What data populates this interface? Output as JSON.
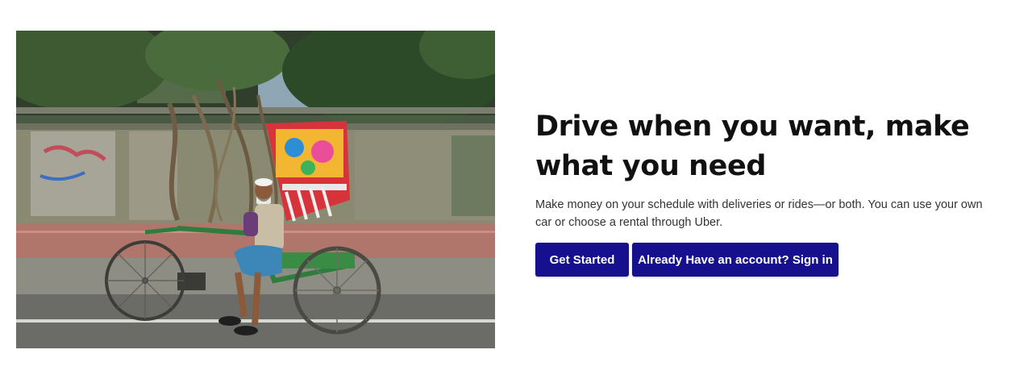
{
  "hero": {
    "image_alt": "Man sitting on a decorated cycle rickshaw in front of a weathered wall with tree roots",
    "title": "Drive when you want, make what you need",
    "subtitle": "Make money on your schedule with deliveries or rides—or both. You can use your own car or choose a rental through Uber.",
    "buttons": {
      "get_started": "Get Started",
      "sign_in": "Already Have an account? Sign in"
    }
  },
  "colors": {
    "button_bg": "#16108f",
    "button_text": "#ffffff",
    "title_text": "#111111",
    "body_text": "#333333"
  }
}
